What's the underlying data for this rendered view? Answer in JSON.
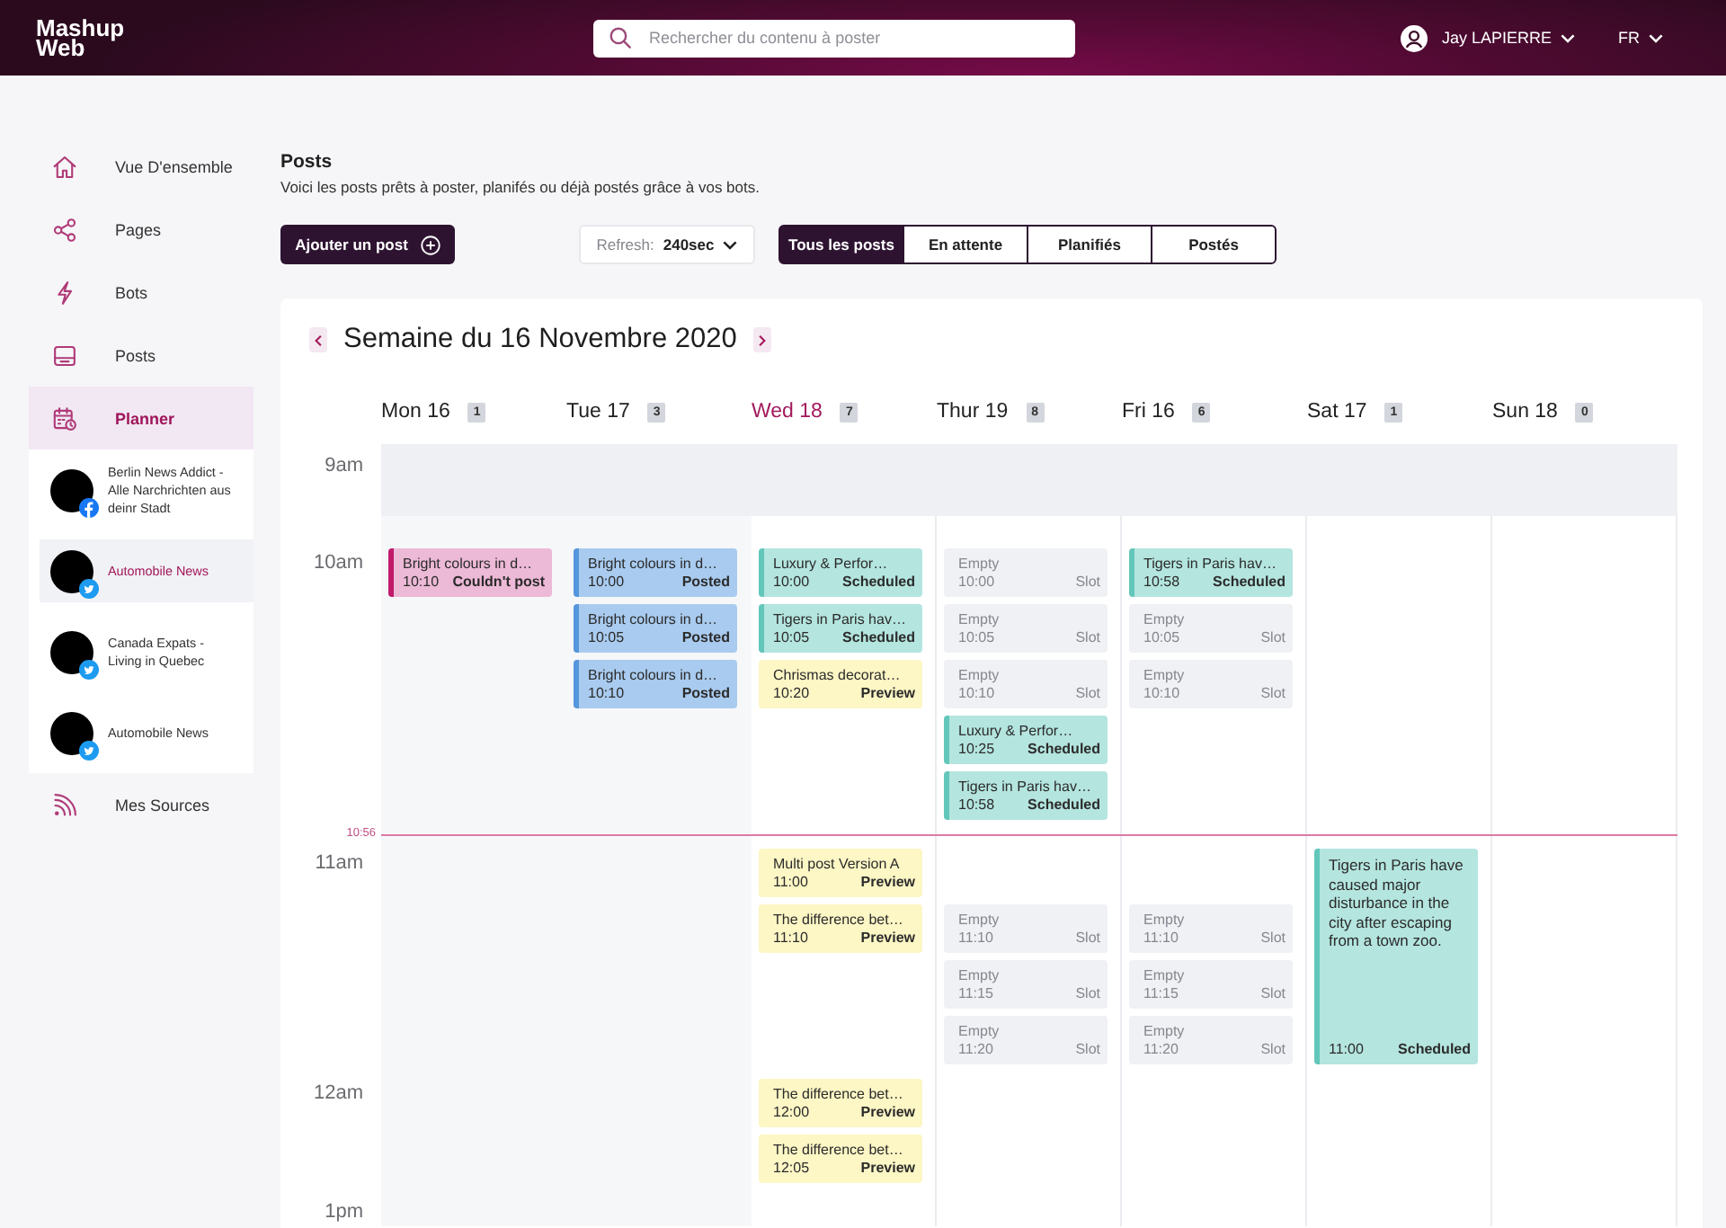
{
  "header": {
    "logo": "Mashup Web",
    "search": {
      "placeholder": "Rechercher du contenu à poster"
    },
    "user": "Jay LAPIERRE",
    "language": "FR"
  },
  "sidebar": {
    "items": [
      {
        "label": "Vue D'ensemble",
        "kind": "overview",
        "selected": false
      },
      {
        "label": "Pages",
        "kind": "pages",
        "selected": false
      },
      {
        "label": "Bots",
        "kind": "bots",
        "selected": false
      },
      {
        "label": "Posts",
        "kind": "posts",
        "selected": false
      },
      {
        "label": "Planner",
        "kind": "planner",
        "selected": true,
        "children": [
          {
            "name": "Berlin News Addict - Alle Narchrichten aus deinr Stadt",
            "kind": "facebook",
            "selected": false
          },
          {
            "name": "Automobile News",
            "kind": "twitter",
            "selected": true
          },
          {
            "name": "Canada Expats - Living in Quebec",
            "kind": "twitter",
            "selected": false
          },
          {
            "name": "Automobile News",
            "kind": "twitter",
            "selected": false
          }
        ]
      },
      {
        "label": "Mes Sources",
        "kind": "sources",
        "selected": false
      }
    ]
  },
  "page": {
    "title": "Posts",
    "subtitle": "Voici les posts prêts à poster, planifés ou déjà postés grâce à vos bots."
  },
  "toolbar": {
    "add_button": "Ajouter un post",
    "refresh": {
      "label": "Refresh:",
      "value": "240sec"
    },
    "filters": [
      {
        "label": "Tous les posts",
        "selected": true
      },
      {
        "label": "En attente",
        "selected": false
      },
      {
        "label": "Planifiés",
        "selected": false
      },
      {
        "label": "Postés",
        "selected": false
      }
    ]
  },
  "calendar": {
    "title": "Semaine du 16 Novembre 2020",
    "days": [
      {
        "label": "Mon 16",
        "count": "1",
        "today": false,
        "past": true
      },
      {
        "label": "Tue 17",
        "count": "3",
        "today": false,
        "past": true
      },
      {
        "label": "Wed 18",
        "count": "7",
        "today": true,
        "past": false
      },
      {
        "label": "Thur 19",
        "count": "8",
        "today": false,
        "past": false
      },
      {
        "label": "Fri 16",
        "count": "6",
        "today": false,
        "past": false
      },
      {
        "label": "Sat 17",
        "count": "1",
        "today": false,
        "past": false
      },
      {
        "label": "Sun 18",
        "count": "0",
        "today": false,
        "past": false
      }
    ],
    "timeline": [
      {
        "kind": "hour",
        "label": "9am",
        "shaded": true
      },
      {
        "kind": "hour",
        "label": "10am",
        "shaded": false,
        "rows": [
          [
            {
              "kind": "failed",
              "title": "Bright colours in d…",
              "time": "10:10",
              "status": "Couldn't post"
            },
            {
              "kind": "posted",
              "title": "Bright colours in d…",
              "time": "10:00",
              "status": "Posted"
            },
            {
              "kind": "scheduled",
              "title": "Luxury & Perfor…",
              "time": "10:00",
              "status": "Scheduled"
            },
            {
              "kind": "empty",
              "title": "Empty",
              "time": "10:00",
              "status": "Slot"
            },
            {
              "kind": "scheduled",
              "title": "Tigers in Paris hav…",
              "time": "10:58",
              "status": "Scheduled"
            },
            null,
            null
          ],
          [
            null,
            {
              "kind": "posted",
              "title": "Bright colours in d…",
              "time": "10:05",
              "status": "Posted"
            },
            {
              "kind": "scheduled",
              "title": "Tigers in Paris hav…",
              "time": "10:05",
              "status": "Scheduled"
            },
            {
              "kind": "empty",
              "title": "Empty",
              "time": "10:05",
              "status": "Slot"
            },
            {
              "kind": "empty",
              "title": "Empty",
              "time": "10:05",
              "status": "Slot"
            },
            null,
            null
          ],
          [
            null,
            {
              "kind": "posted",
              "title": "Bright colours in d…",
              "time": "10:10",
              "status": "Posted"
            },
            {
              "kind": "preview",
              "title": "Chrismas decorat…",
              "time": "10:20",
              "status": "Preview"
            },
            {
              "kind": "empty",
              "title": "Empty",
              "time": "10:10",
              "status": "Slot"
            },
            {
              "kind": "empty",
              "title": "Empty",
              "time": "10:10",
              "status": "Slot"
            },
            null,
            null
          ],
          [
            null,
            null,
            null,
            {
              "kind": "scheduled",
              "title": "Luxury & Perfor…",
              "time": "10:25",
              "status": "Scheduled"
            },
            null,
            null,
            null
          ],
          [
            null,
            null,
            null,
            {
              "kind": "scheduled",
              "title": "Tigers in Paris hav…",
              "time": "10:58",
              "status": "Scheduled"
            },
            null,
            null,
            null
          ]
        ]
      },
      {
        "kind": "now",
        "label": "10:56"
      },
      {
        "kind": "hour",
        "label": "11am",
        "shaded": false,
        "rows": [
          [
            null,
            null,
            {
              "kind": "preview",
              "title": "Multi post Version A",
              "time": "11:00",
              "status": "Preview"
            },
            null,
            null,
            null,
            null
          ],
          [
            null,
            null,
            {
              "kind": "preview",
              "title": "The difference bet…",
              "time": "11:10",
              "status": "Preview"
            },
            {
              "kind": "empty",
              "title": "Empty",
              "time": "11:10",
              "status": "Slot"
            },
            {
              "kind": "empty",
              "title": "Empty",
              "time": "11:10",
              "status": "Slot"
            },
            null,
            null
          ],
          [
            null,
            null,
            null,
            {
              "kind": "empty",
              "title": "Empty",
              "time": "11:15",
              "status": "Slot"
            },
            {
              "kind": "empty",
              "title": "Empty",
              "time": "11:15",
              "status": "Slot"
            },
            null,
            null
          ],
          [
            null,
            null,
            null,
            {
              "kind": "empty",
              "title": "Empty",
              "time": "11:20",
              "status": "Slot"
            },
            {
              "kind": "empty",
              "title": "Empty",
              "time": "11:20",
              "status": "Slot"
            },
            null,
            null
          ]
        ],
        "full_posts": [
          {
            "kind": "saturday",
            "post": {
              "kind": "scheduled",
              "title": "Tigers in Paris have caused major disturbance in the city after escaping from a town zoo.",
              "time": "11:00",
              "status": "Scheduled"
            }
          }
        ]
      },
      {
        "kind": "hour",
        "label": "12am",
        "shaded": false,
        "rows": [
          [
            null,
            null,
            {
              "kind": "preview",
              "title": "The difference bet…",
              "time": "12:00",
              "status": "Preview"
            },
            null,
            null,
            null,
            null
          ],
          [
            null,
            null,
            {
              "kind": "preview",
              "title": "The difference bet…",
              "time": "12:05",
              "status": "Preview"
            },
            null,
            null,
            null,
            null
          ]
        ]
      },
      {
        "kind": "hour",
        "label": "1pm",
        "shaded": false
      }
    ]
  }
}
